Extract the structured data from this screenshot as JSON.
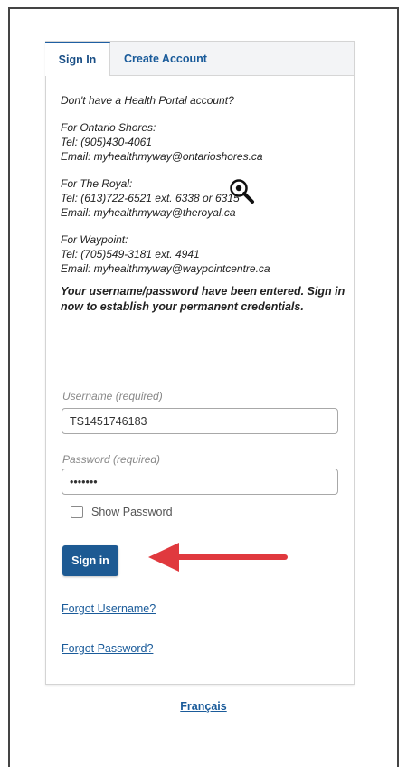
{
  "tabs": {
    "signin": "Sign In",
    "create": "Create Account"
  },
  "intro": "Don't have a Health Portal account?",
  "contacts": [
    {
      "org": "For Ontario Shores:",
      "tel": "Tel: (905)430-4061",
      "email": "Email: myhealthmyway@ontarioshores.ca"
    },
    {
      "org": "For The Royal:",
      "tel": "Tel: (613)722-6521 ext. 6338 or 6315",
      "email": "Email: myhealthmyway@theroyal.ca"
    },
    {
      "org": "For Waypoint:",
      "tel": "Tel: (705)549-3181 ext. 4941",
      "email": "Email: myhealthmyway@waypointcentre.ca"
    }
  ],
  "notice": "Your username/password have been entered. Sign in now to establish your permanent credentials.",
  "username": {
    "label": "Username (required)",
    "value": "TS1451746183"
  },
  "password": {
    "label": "Password (required)",
    "value": "•••••••"
  },
  "show_password": {
    "label": "Show Password",
    "checked": false
  },
  "signin_button": "Sign in",
  "links": {
    "forgot_username": "Forgot Username?",
    "forgot_password": "Forgot Password?"
  },
  "language_link": "Français",
  "colors": {
    "primary": "#1d5a93",
    "link": "#1a5b9a",
    "arrow": "#e0393e"
  },
  "icons": {
    "cursor": "zoom-cursor-icon",
    "arrow": "left-arrow-icon"
  }
}
